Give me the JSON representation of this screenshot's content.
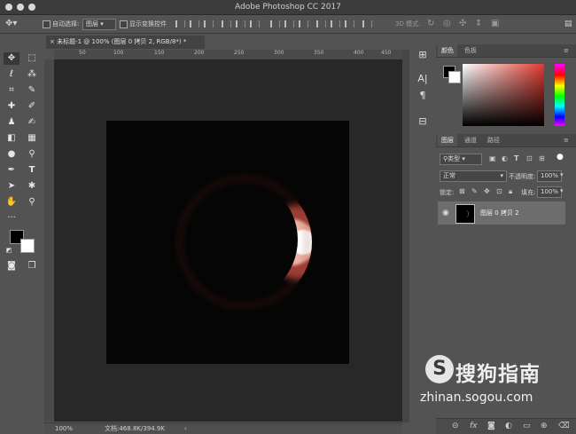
{
  "window": {
    "title": "Adobe Photoshop CC 2017"
  },
  "options_bar": {
    "auto_select_label": "自动选择:",
    "auto_select_value": "图层",
    "show_transform_label": "显示变换控件",
    "mode_3d_label": "3D 模式:"
  },
  "document": {
    "tab_title": "未标题-1 @ 100% (图层 0 拷贝 2, RGB/8*) *",
    "ruler_labels": [
      "50",
      "100",
      "150",
      "200",
      "250",
      "300",
      "350",
      "400",
      "450"
    ],
    "zoom": "100%",
    "doc_info": "文档:468.8K/394.9K"
  },
  "color_panel": {
    "tabs": [
      "颜色",
      "色板"
    ],
    "foreground_color": "#000000",
    "background_color": "#ffffff",
    "current_color": "#e03a30"
  },
  "layers_panel": {
    "tabs": [
      "图层",
      "通道",
      "路径"
    ],
    "filter_kind": "类型",
    "blend_mode": "正常",
    "opacity_label": "不透明度:",
    "opacity_value": "100%",
    "lock_label": "锁定:",
    "fill_label": "填充:",
    "fill_value": "100%",
    "layers": [
      {
        "name": "图层 0 拷贝 2",
        "visible": true,
        "selected": true
      }
    ]
  },
  "watermark": {
    "brand": "搜狗指南",
    "url": "zhinan.sogou.com"
  },
  "icons": [
    "move-icon",
    "marquee-icon",
    "lasso-icon",
    "magic-wand-icon",
    "crop-icon",
    "eyedropper-icon",
    "healing-icon",
    "brush-icon",
    "stamp-icon",
    "history-brush-icon",
    "eraser-icon",
    "gradient-icon",
    "blur-icon",
    "dodge-icon",
    "pen-icon",
    "type-icon",
    "path-select-icon",
    "shape-icon",
    "hand-icon",
    "zoom-icon",
    "eye-icon"
  ]
}
